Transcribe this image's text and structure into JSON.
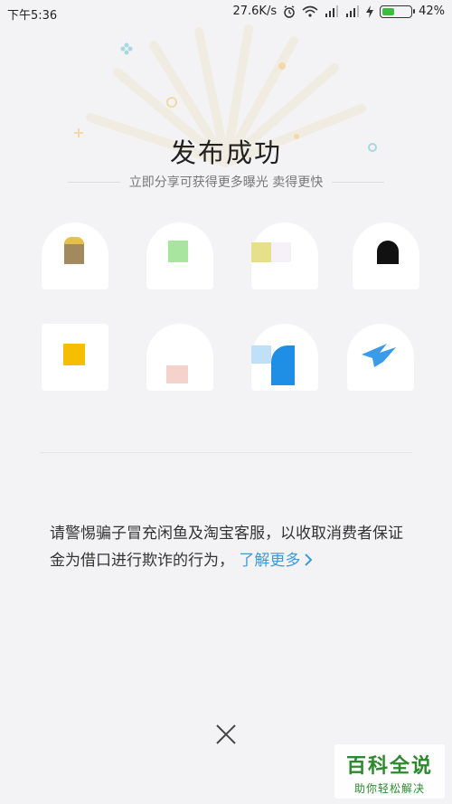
{
  "status_bar": {
    "time": "下午5:36",
    "network_speed": "27.6K/s",
    "battery_text": "42%",
    "battery_level": 0.42
  },
  "header": {
    "title": "发布成功",
    "subtitle": "立即分享可获得更多曝光 卖得更快"
  },
  "share_targets": [
    {
      "icon": "share-icon-1",
      "color": "#a38a5e"
    },
    {
      "icon": "share-icon-2",
      "color": "#a8e6a0"
    },
    {
      "icon": "share-icon-3",
      "color": "#e6e08a"
    },
    {
      "icon": "share-icon-4",
      "color": "#111111"
    },
    {
      "icon": "share-icon-5",
      "color": "#f5be00"
    },
    {
      "icon": "share-icon-6",
      "color": "#f6d2cc"
    },
    {
      "icon": "share-icon-7",
      "color": "#1f8fe6"
    },
    {
      "icon": "share-icon-8",
      "color": "#3a9be8"
    }
  ],
  "notice": {
    "text": "请警惕骗子冒充闲鱼及淘宝客服，以收取消费者保证金为借口进行欺诈的行为，",
    "link": "了解更多"
  },
  "close": {
    "icon": "close-icon"
  },
  "watermark": {
    "main": "百科全说",
    "sub": "助你轻松解决"
  }
}
